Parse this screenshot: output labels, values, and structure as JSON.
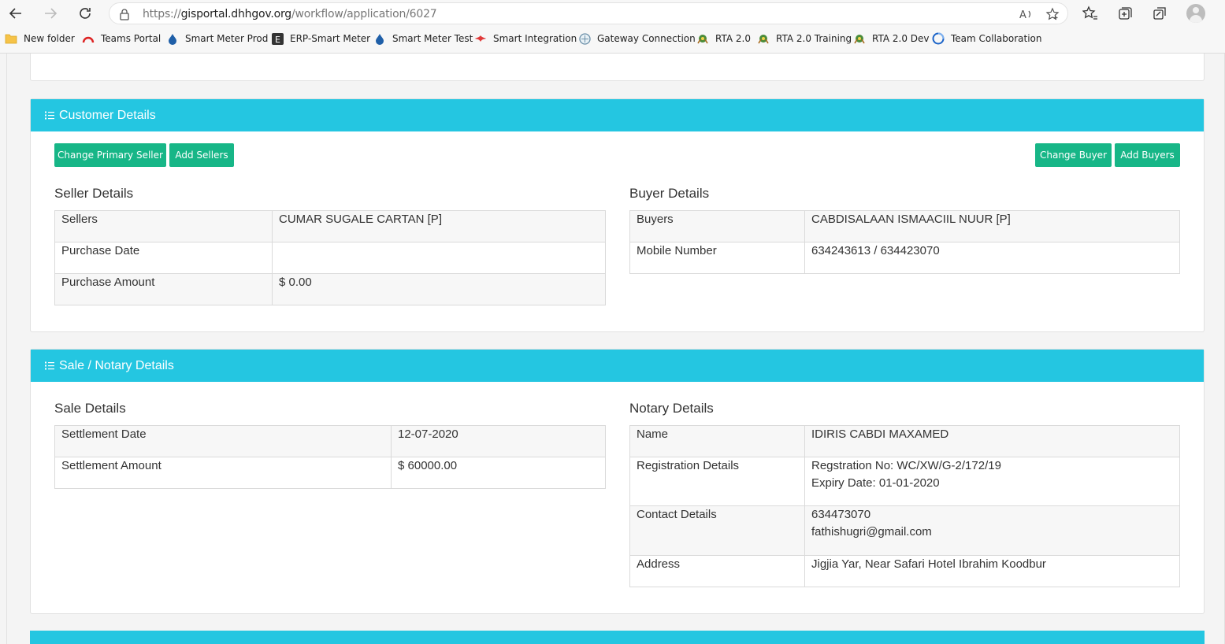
{
  "browser": {
    "url_prefix": "https://",
    "url_host": "gisportal.dhhgov.org",
    "url_path": "/workflow/application/6027",
    "bookmarks": [
      {
        "label": "New folder",
        "icon": "folder-icon"
      },
      {
        "label": "Teams Portal",
        "icon": "teams-portal-icon"
      },
      {
        "label": "Smart Meter Prod",
        "icon": "droplet-icon"
      },
      {
        "label": "ERP-Smart Meter",
        "icon": "erp-icon"
      },
      {
        "label": "Smart Meter Test",
        "icon": "droplet-icon"
      },
      {
        "label": "Smart Integration",
        "icon": "integration-icon"
      },
      {
        "label": "Gateway Connection",
        "icon": "gateway-icon"
      },
      {
        "label": "RTA 2.0",
        "icon": "rta-icon"
      },
      {
        "label": "RTA 2.0 Training",
        "icon": "rta-icon"
      },
      {
        "label": "RTA 2.0 Dev",
        "icon": "rta-icon"
      },
      {
        "label": "Team Collaboration",
        "icon": "collaboration-icon"
      }
    ]
  },
  "customer": {
    "header": "Customer Details",
    "buttons": {
      "change_primary_seller": "Change Primary Seller",
      "add_sellers": "Add Sellers",
      "change_buyer": "Change Buyer",
      "add_buyers": "Add Buyers"
    },
    "seller_title": "Seller Details",
    "seller_rows": [
      {
        "label": "Sellers",
        "value": "CUMAR SUGALE CARTAN [P]"
      },
      {
        "label": "Purchase Date",
        "value": ""
      },
      {
        "label": "Purchase Amount",
        "value": "$ 0.00"
      }
    ],
    "buyer_title": "Buyer Details",
    "buyer_rows": [
      {
        "label": "Buyers",
        "value": "CABDISALAAN ISMAACIIL NUUR [P]"
      },
      {
        "label": "Mobile Number",
        "value": "634243613 / 634423070"
      }
    ]
  },
  "sale": {
    "header": "Sale / Notary Details",
    "sale_title": "Sale Details",
    "sale_rows": [
      {
        "label": "Settlement Date",
        "value": "12-07-2020"
      },
      {
        "label": "Settlement Amount",
        "value": "$ 60000.00"
      }
    ],
    "notary_title": "Notary Details",
    "notary_rows": [
      {
        "label": "Name",
        "value": "IDIRIS CABDI MAXAMED",
        "value2": ""
      },
      {
        "label": "Registration Details",
        "value": "Regstration No: WC/XW/G-2/172/19",
        "value2": "Expiry Date: 01-01-2020"
      },
      {
        "label": "Contact Details",
        "value": "634473070",
        "value2": "fathishugri@gmail.com"
      },
      {
        "label": "Address",
        "value": "Jigjia Yar, Near Safari Hotel Ibrahim Koodbur",
        "value2": ""
      }
    ]
  },
  "colors": {
    "header_bg": "#24c6e1",
    "button_bg": "#17b687"
  }
}
